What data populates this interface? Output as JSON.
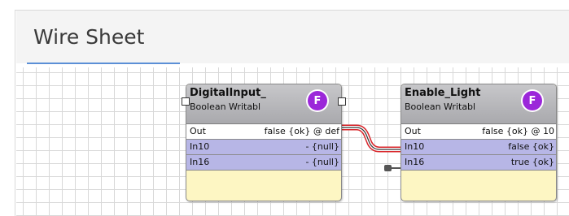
{
  "tab": {
    "title": "Wire Sheet"
  },
  "nodes": [
    {
      "name": "DigitalInput_",
      "type": "Boolean Writabl",
      "badge": "F",
      "slots": [
        {
          "name": "Out",
          "value": "false {ok} @ def"
        },
        {
          "name": "In10",
          "value": "- {null}"
        },
        {
          "name": "In16",
          "value": "- {null}"
        }
      ]
    },
    {
      "name": "Enable_Light",
      "type": "Boolean Writabl",
      "badge": "F",
      "slots": [
        {
          "name": "Out",
          "value": "false {ok} @ 10"
        },
        {
          "name": "In10",
          "value": "false {ok}"
        },
        {
          "name": "In16",
          "value": "true {ok}"
        }
      ]
    }
  ],
  "colors": {
    "accent": "#5b8fd6",
    "badge": "#9b27d9",
    "node_body": "#fdf6c3",
    "input_slot": "#b7b6e6",
    "wire": "#d9252a"
  }
}
